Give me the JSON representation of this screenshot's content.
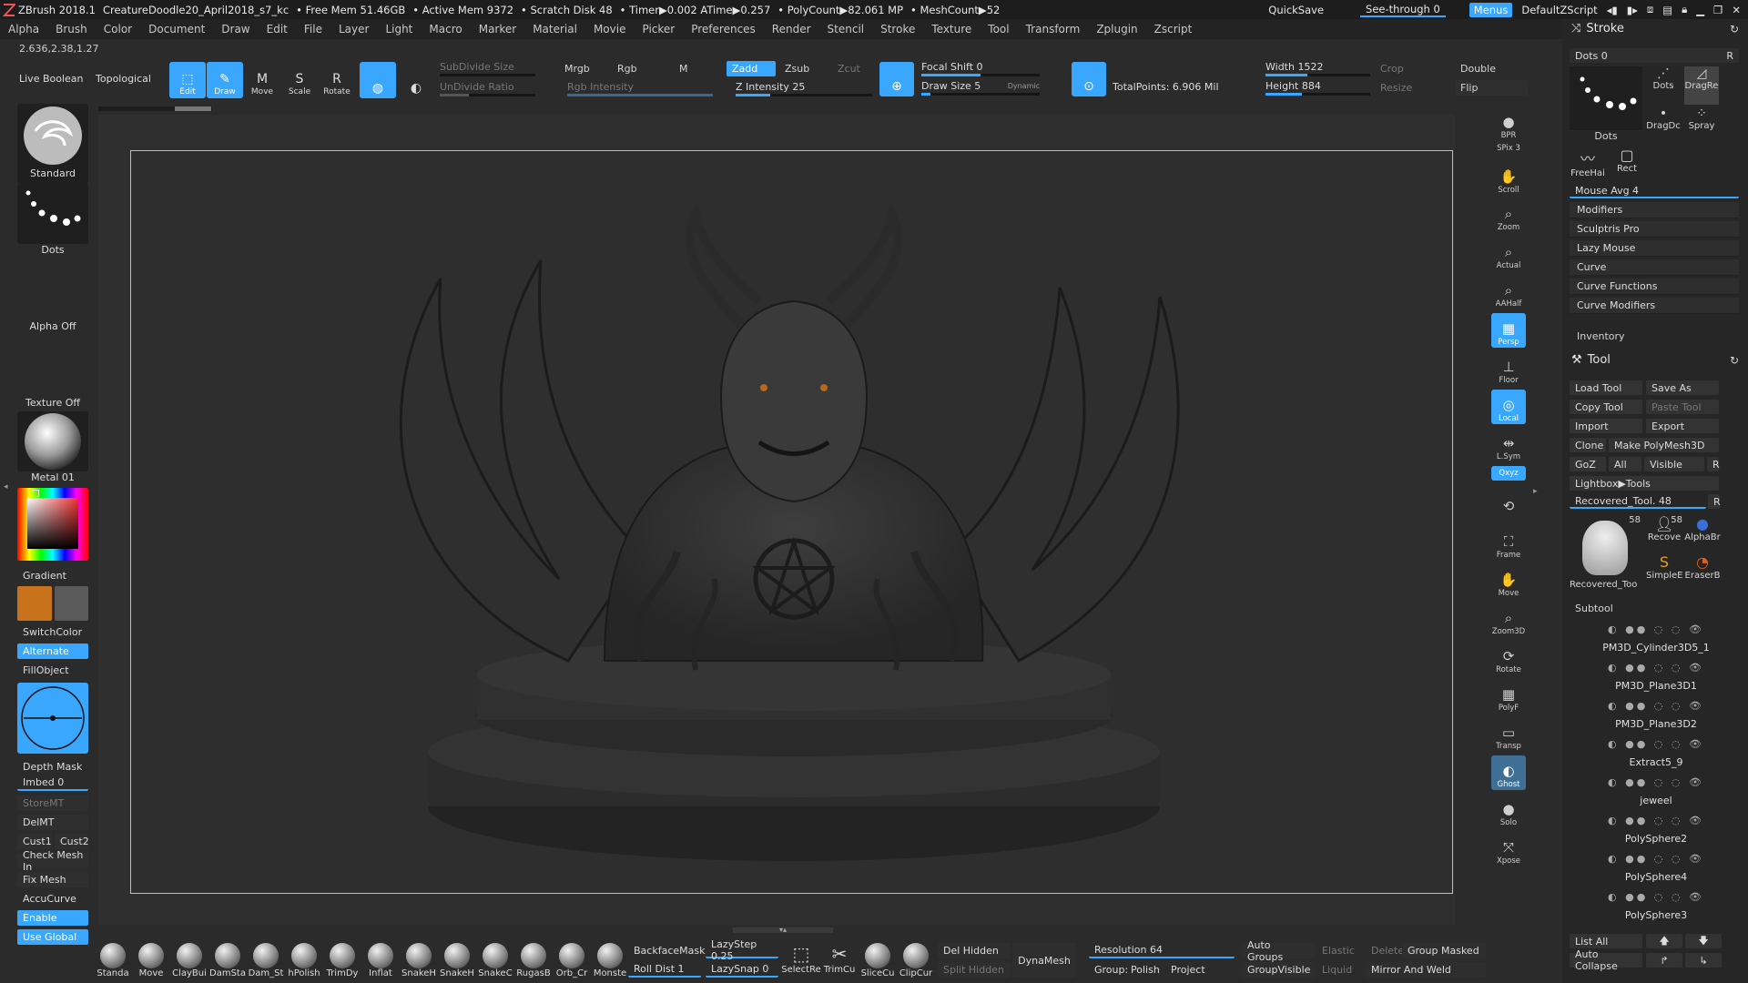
{
  "titlebar": {
    "app": "ZBrush 2018.1",
    "project": "CreatureDoodle20_April2018_s7_kc",
    "stats": [
      "• Free Mem 51.46GB",
      "• Active Mem 9372",
      "• Scratch Disk 48",
      "• Timer▶0.002 ATime▶0.257",
      "• PolyCount▶82.061 MP",
      "• MeshCount▶52"
    ],
    "quicksave": "QuickSave",
    "seethrough": "See-through  0",
    "menus": "Menus",
    "script": "DefaultZScript"
  },
  "menubar": [
    "Alpha",
    "Brush",
    "Color",
    "Document",
    "Draw",
    "Edit",
    "File",
    "Layer",
    "Light",
    "Macro",
    "Marker",
    "Material",
    "Movie",
    "Picker",
    "Preferences",
    "Render",
    "Stencil",
    "Stroke",
    "Texture",
    "Tool",
    "Transform",
    "Zplugin",
    "Zscript"
  ],
  "coords": "2.636,2.38,1.27",
  "topshelf": {
    "live_boolean": "Live Boolean",
    "topological": "Topological",
    "edit": "Edit",
    "draw": "Draw",
    "move": "Move",
    "scale": "Scale",
    "rotate": "Rotate",
    "subdivide": "SubDivide Size",
    "undivide": "UnDivide Ratio",
    "mrgb": "Mrgb",
    "rgb": "Rgb",
    "m": "M",
    "rgb_intensity": "Rgb Intensity",
    "zadd": "Zadd",
    "zsub": "Zsub",
    "zcut": "Zcut",
    "z_intensity": "Z Intensity 25",
    "focal_shift": "Focal Shift 0",
    "draw_size": "Draw Size 5",
    "dynamic": "Dynamic",
    "total_points": "TotalPoints:  6.906 Mil",
    "width": "Width 1522",
    "height": "Height 884",
    "crop": "Crop",
    "resize": "Resize",
    "double": "Double",
    "flip": "Flip"
  },
  "left": {
    "brush": "Standard",
    "stroke": "Dots",
    "alpha": "Alpha Off",
    "texture": "Texture Off",
    "material": "Metal 01",
    "gradient": "Gradient",
    "switchcolor": "SwitchColor",
    "alternate": "Alternate",
    "fillobject": "FillObject",
    "depthmask": "Depth Mask",
    "imbed": "Imbed 0",
    "storemt": "StoreMT",
    "delmt": "DelMT",
    "cust1": "Cust1",
    "cust2": "Cust2",
    "checkmesh": "Check Mesh In",
    "fixmesh": "Fix Mesh",
    "accucurve": "AccuCurve",
    "enable": "Enable",
    "useglobal": "Use Global",
    "main_color": "#c8731c",
    "secondary_color": "#5a5a5a"
  },
  "nav": [
    {
      "name": "bpr",
      "label": "BPR",
      "ic": "◉"
    },
    {
      "name": "spix",
      "label": "SPix 3",
      "ic": ""
    },
    {
      "name": "scroll",
      "label": "Scroll",
      "ic": "✋"
    },
    {
      "name": "zoom",
      "label": "Zoom",
      "ic": "⌕"
    },
    {
      "name": "actual",
      "label": "Actual",
      "ic": "⌕"
    },
    {
      "name": "aahalf",
      "label": "AAHalf",
      "ic": "⌕"
    },
    {
      "name": "persp",
      "label": "Persp",
      "ic": "▦"
    },
    {
      "name": "floor",
      "label": "Floor",
      "ic": "⊥"
    },
    {
      "name": "local",
      "label": "Local",
      "ic": "◎"
    },
    {
      "name": "lsym",
      "label": "L.Sym",
      "ic": "⇹"
    },
    {
      "name": "xyz",
      "label": "Qxyz",
      "ic": ""
    },
    {
      "name": "frame",
      "label": "Frame",
      "ic": "⛶"
    },
    {
      "name": "move",
      "label": "Move",
      "ic": "✋"
    },
    {
      "name": "zoom3d",
      "label": "Zoom3D",
      "ic": "⌕"
    },
    {
      "name": "rotate",
      "label": "Rotate",
      "ic": "⟳"
    },
    {
      "name": "polyf",
      "label": "PolyF",
      "ic": "▦"
    },
    {
      "name": "transp",
      "label": "Transp",
      "ic": "▭"
    },
    {
      "name": "ghost",
      "label": "Ghost",
      "ic": "◐"
    },
    {
      "name": "solo",
      "label": "Solo",
      "ic": "●"
    },
    {
      "name": "xpose",
      "label": "Xpose",
      "ic": "⤧"
    }
  ],
  "stroke": {
    "title": "Stroke",
    "dots": "Dots  0",
    "r": "R",
    "dots_label": "Dots",
    "dragrect": "DragRe",
    "dragdot": "DragDc",
    "spray": "Spray",
    "freehand": "FreeHai",
    "rect": "Rect",
    "mouse_avg": "Mouse Avg 4",
    "rows": [
      "Modifiers",
      "Sculptris Pro",
      "Lazy Mouse",
      "Curve",
      "Curve Functions",
      "Curve Modifiers"
    ],
    "inventory": "Inventory"
  },
  "tool": {
    "title": "Tool",
    "load": "Load Tool",
    "saveas": "Save As",
    "copy": "Copy Tool",
    "paste": "Paste Tool",
    "import": "Import",
    "export": "Export",
    "clone": "Clone",
    "makepoly": "Make PolyMesh3D",
    "goz": "GoZ",
    "all": "All",
    "visible": "Visible",
    "r": "R",
    "lightbox": "Lightbox▶Tools",
    "recovered": "Recovered_Tool. 48",
    "count1": "58",
    "count2": "58",
    "thumb1": "Recovered_Too",
    "thumb2": "Recove",
    "thumb3": "AlphaBr",
    "thumb4": "SimpleE",
    "thumb5": "EraserB",
    "subtool": "Subtool",
    "subtools": [
      "PM3D_Cylinder3D5_1",
      "PM3D_Plane3D1",
      "PM3D_Plane3D2",
      "Extract5_9",
      "jeweel",
      "PolySphere2",
      "PolySphere4",
      "PolySphere3"
    ],
    "listall": "List All",
    "autocollapse": "Auto Collapse"
  },
  "bottom": {
    "brushes": [
      "Standa",
      "Move",
      "ClayBui",
      "DamSta",
      "Dam_St",
      "hPolish",
      "TrimDy",
      "Inflat",
      "SnakeH",
      "SnakeH",
      "SnakeC",
      "RugasB",
      "Orb_Cr",
      "Monste"
    ],
    "backfacemask": "BackfaceMask",
    "lazystep": "LazyStep 0.25",
    "rolldist": "Roll Dist 1",
    "lazysnap": "LazySnap 0",
    "selectr": "SelectRe",
    "trimcu": "TrimCu",
    "slicecu": "SliceCu",
    "clipcur": "ClipCur",
    "delhidden": "Del Hidden",
    "splithidden": "Split Hidden",
    "dynamesh": "DynaMesh",
    "resolution": "Resolution 64",
    "group": "Group:",
    "polish": "Polish",
    "project": "Project",
    "autogroups": "Auto Groups",
    "elastic": "Elastic",
    "delete": "Delete",
    "groupmasked": "Group Masked",
    "groupvisible": "GroupVisible",
    "liquid": "Liquid",
    "mirrorweld": "Mirror And Weld"
  }
}
